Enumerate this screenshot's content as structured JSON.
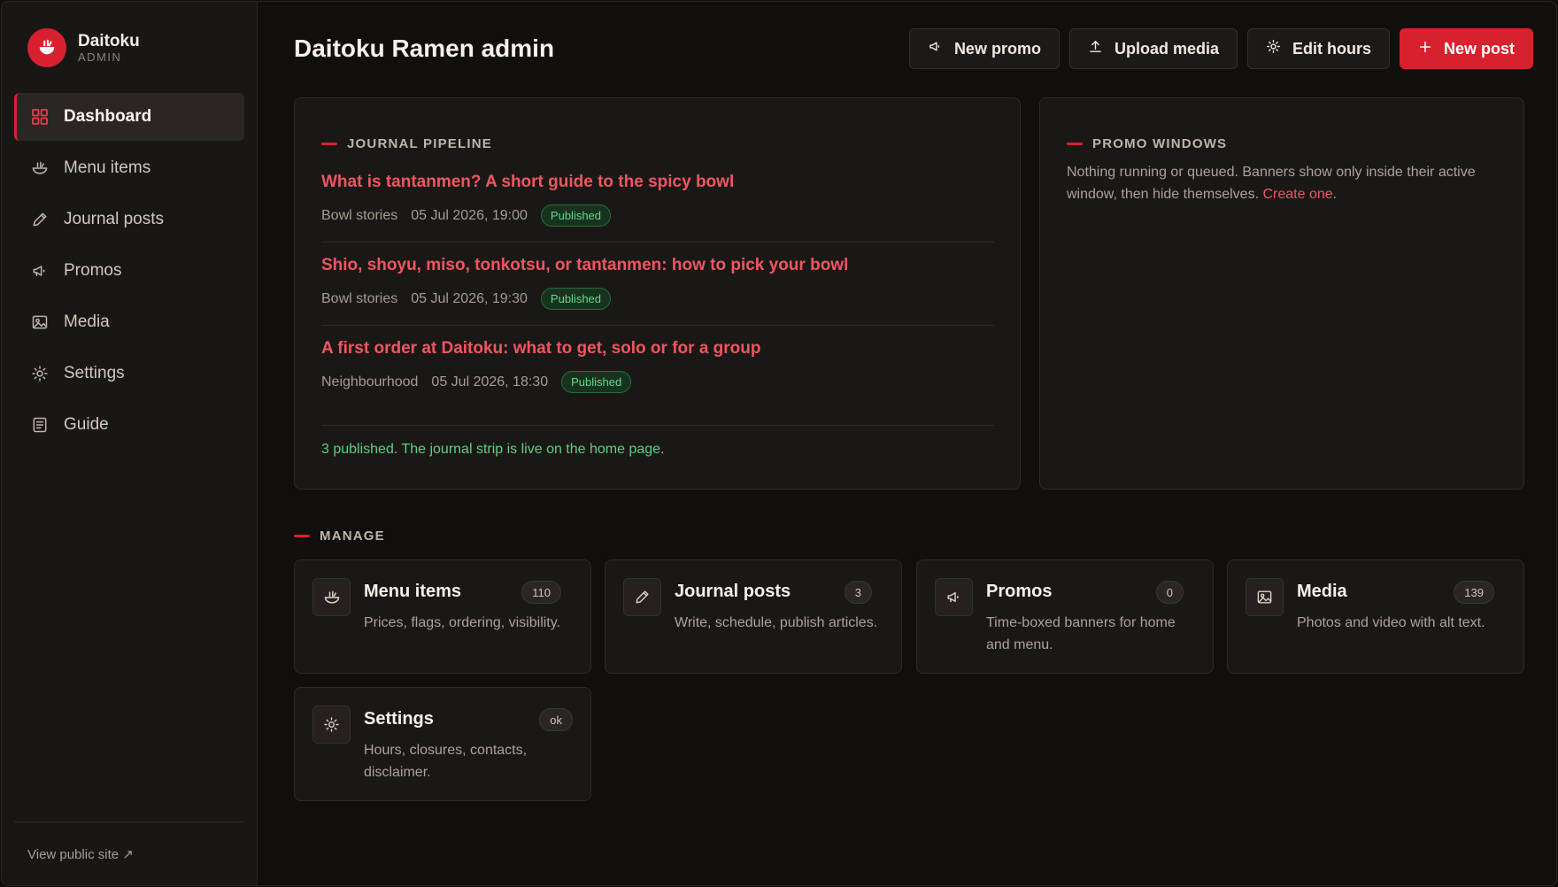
{
  "brand": {
    "name": "Daitoku",
    "sub": "ADMIN"
  },
  "nav": [
    {
      "label": "Dashboard",
      "icon": "grid-icon",
      "active": true
    },
    {
      "label": "Menu items",
      "icon": "bowl-icon"
    },
    {
      "label": "Journal posts",
      "icon": "pencil-icon"
    },
    {
      "label": "Promos",
      "icon": "megaphone-icon"
    },
    {
      "label": "Media",
      "icon": "image-icon"
    },
    {
      "label": "Settings",
      "icon": "gear-icon"
    },
    {
      "label": "Guide",
      "icon": "document-icon"
    }
  ],
  "sidebar_footer": {
    "link": "View public site ↗"
  },
  "header": {
    "title": "Daitoku Ramen admin",
    "actions": {
      "new_promo": "New promo",
      "upload_media": "Upload media",
      "edit_hours": "Edit hours",
      "new_post": "New post"
    }
  },
  "pipeline": {
    "label": "JOURNAL PIPELINE",
    "posts": [
      {
        "title": "What is tantanmen? A short guide to the spicy bowl",
        "category": "Bowl stories",
        "date": "05 Jul 2026, 19:00",
        "status": "Published"
      },
      {
        "title": "Shio, shoyu, miso, tonkotsu, or tantanmen: how to pick your bowl",
        "category": "Bowl stories",
        "date": "05 Jul 2026, 19:30",
        "status": "Published"
      },
      {
        "title": "A first order at Daitoku: what to get, solo or for a group",
        "category": "Neighbourhood",
        "date": "05 Jul 2026, 18:30",
        "status": "Published"
      }
    ],
    "footer": "3 published. The journal strip is live on the home page."
  },
  "promo_windows": {
    "label": "PROMO WINDOWS",
    "text": "Nothing running or queued. Banners show only inside their active window, then hide themselves.",
    "link": "Create one",
    "trailing": "."
  },
  "manage": {
    "label": "MANAGE",
    "cards": [
      {
        "title": "Menu items",
        "count": "110",
        "desc": "Prices, flags, ordering, visibility.",
        "icon": "bowl-icon"
      },
      {
        "title": "Journal posts",
        "count": "3",
        "desc": "Write, schedule, publish articles.",
        "icon": "pencil-icon"
      },
      {
        "title": "Promos",
        "count": "0",
        "desc": "Time-boxed banners for home and menu.",
        "icon": "megaphone-icon"
      },
      {
        "title": "Media",
        "count": "139",
        "desc": "Photos and video with alt text.",
        "icon": "image-icon"
      },
      {
        "title": "Settings",
        "count": "ok",
        "desc": "Hours, closures, contacts, disclaimer.",
        "icon": "gear-icon"
      }
    ]
  },
  "colors": {
    "accent": "#d8212e",
    "link": "#f0565f",
    "success": "#5fcf7f",
    "background": "#110f0e"
  }
}
